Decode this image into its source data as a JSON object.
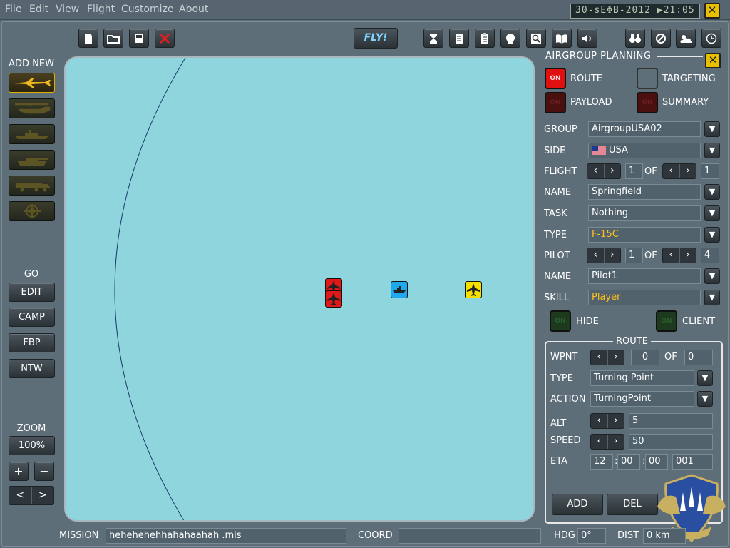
{
  "menu": [
    "File",
    "Edit",
    "View",
    "Flight",
    "Customize",
    "About"
  ],
  "datetime": "30-sEΦB-2012 ▶21:05",
  "close_symbol": "✕",
  "toolbar": {
    "fly_label": "FLY!",
    "file_icons": [
      "new-file-icon",
      "open-folder-icon",
      "save-icon",
      "close-mission-icon"
    ],
    "tool_icons": [
      "hourglass-icon",
      "briefing-icon",
      "checklist-icon",
      "head-icon",
      "zoom-search-icon",
      "book-icon",
      "speaker-icon"
    ],
    "view_icons": [
      "binoculars-icon",
      "no-entry-icon",
      "weather-icon",
      "clock-icon"
    ]
  },
  "left": {
    "add_new_label": "ADD NEW",
    "unit_icons": [
      "aircraft-icon",
      "helicopter-icon",
      "ship-icon",
      "tank-icon",
      "vehicle-icon",
      "target-icon"
    ],
    "go_label": "GO",
    "go_buttons": [
      "EDIT",
      "CAMP",
      "FBP",
      "NTW"
    ],
    "zoom_label": "ZOOM",
    "zoom_value": "100%",
    "zoom_in": "+",
    "zoom_out": "−",
    "prev": "<",
    "next": ">"
  },
  "right": {
    "title": "AIRGROUP PLANNING",
    "route_label": "ROUTE",
    "targeting_label": "TARGETING",
    "payload_label": "PAYLOAD",
    "summary_label": "SUMMARY",
    "on_text": "ON",
    "group_label": "GROUP",
    "group_value": "AirgroupUSA02",
    "side_label": "SIDE",
    "side_value": "USA",
    "flight_label": "FLIGHT",
    "flight_num": "1",
    "of_label": "OF",
    "flight_total": "1",
    "name_label": "NAME",
    "name_value": "Springfield",
    "task_label": "TASK",
    "task_value": "Nothing",
    "type_label": "TYPE",
    "type_value": "F-15C",
    "pilot_label": "PILOT",
    "pilot_num": "1",
    "pilot_total": "4",
    "pilot_name_label": "NAME",
    "pilot_name_value": "Pilot1",
    "skill_label": "SKILL",
    "skill_value": "Player",
    "hide_label": "HIDE",
    "client_label": "CLIENT",
    "route_box": {
      "title": "ROUTE",
      "wpnt_label": "WPNT",
      "wpnt_num": "0",
      "of_label": "OF",
      "wpnt_total": "0",
      "type_label": "TYPE",
      "type_value": "Turning Point",
      "action_label": "ACTION",
      "action_value": "TurningPoint",
      "alt_label": "ALT",
      "alt_value": "5",
      "speed_label": "SPEED",
      "speed_value": "50",
      "eta_label": "ETA",
      "eta_h": "12",
      "eta_m": "00",
      "eta_s": "00",
      "eta_d": "001",
      "colon": ":",
      "add_label": "ADD",
      "del_label": "DEL"
    }
  },
  "bottom": {
    "mission_label": "MISSION",
    "mission_value": "hehehehehhahahaahah  .mis",
    "coord_label": "COORD",
    "coord_value": "",
    "hdg_label": "HDG",
    "hdg_value": "0°",
    "dist_label": "DIST",
    "dist_value": "0 km"
  },
  "colors": {
    "background": "#5e6e78",
    "map": "#8fd5de",
    "red_unit": "#e01818",
    "blue_unit": "#20a8ee",
    "yellow_unit": "#f5e000",
    "highlight": "#ffc020"
  }
}
